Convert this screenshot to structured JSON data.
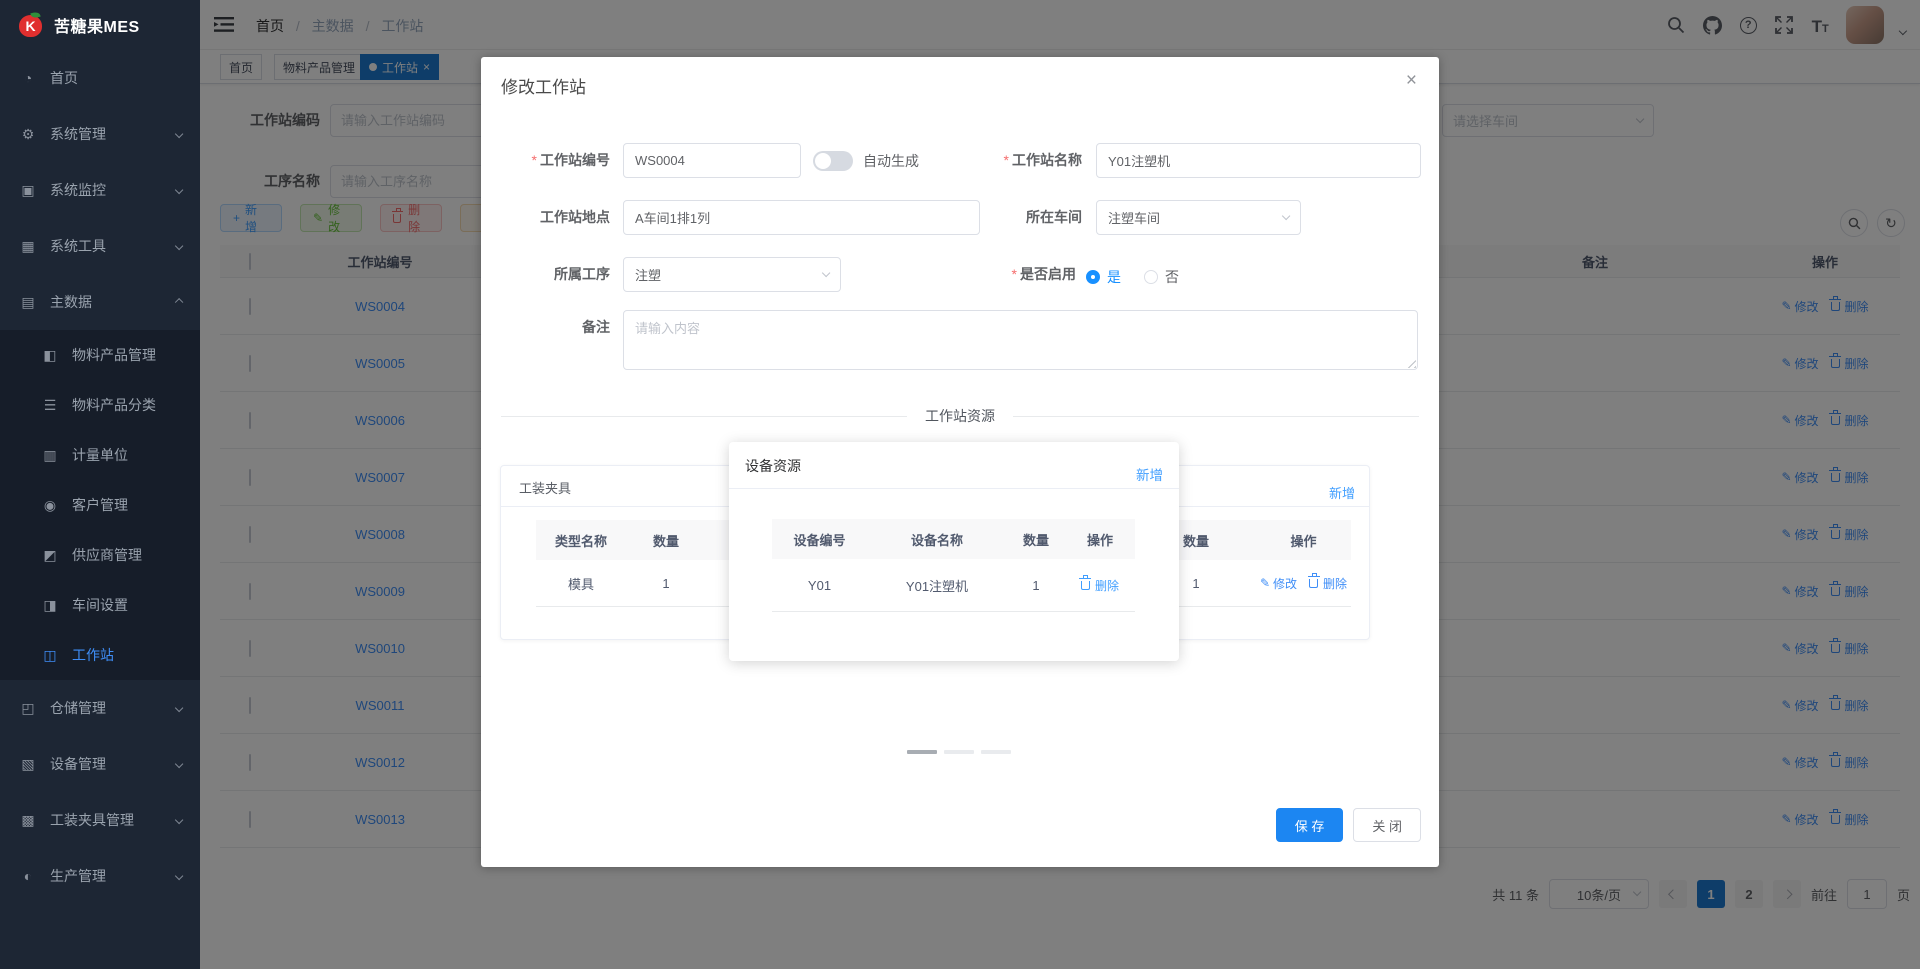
{
  "app": {
    "title": "苦糖果MES"
  },
  "sidebar": {
    "items_top": [
      {
        "label": "首页",
        "glyph": "◔"
      },
      {
        "label": "系统管理",
        "glyph": "⚙"
      },
      {
        "label": "系统监控",
        "glyph": "▣"
      },
      {
        "label": "系统工具",
        "glyph": "▦"
      },
      {
        "label": "主数据",
        "glyph": "▤"
      }
    ],
    "sub_master": [
      {
        "label": "物料产品管理",
        "glyph": "◧"
      },
      {
        "label": "物料产品分类",
        "glyph": "☰"
      },
      {
        "label": "计量单位",
        "glyph": "▥"
      },
      {
        "label": "客户管理",
        "glyph": "◉"
      },
      {
        "label": "供应商管理",
        "glyph": "◩"
      },
      {
        "label": "车间设置",
        "glyph": "◨"
      },
      {
        "label": "工作站",
        "glyph": "◫"
      }
    ],
    "items_bottom": [
      {
        "label": "仓储管理",
        "glyph": "◰"
      },
      {
        "label": "设备管理",
        "glyph": "▧"
      },
      {
        "label": "工装夹具管理",
        "glyph": "▩"
      },
      {
        "label": "生产管理",
        "glyph": "◐"
      }
    ]
  },
  "navbar": {
    "separator": "/",
    "breadcrumb": [
      "首页",
      "主数据",
      "工作站"
    ],
    "question_glyph": "?",
    "font_large": "T",
    "font_small": "T"
  },
  "tags": [
    {
      "label": "首页"
    },
    {
      "label": "物料产品管理"
    },
    {
      "label": "工作站"
    }
  ],
  "icons": {
    "close": "×",
    "pencil": "✎",
    "plus": "+",
    "refresh": "↻"
  },
  "search": {
    "code_label": "工作站编码",
    "code_placeholder": "请输入工作站编码",
    "process_label": "工序名称",
    "process_placeholder": "请输入工序名称",
    "workshop_placeholder": "请选择车间"
  },
  "toolbar": {
    "add": "新增",
    "edit": "修改",
    "delete": "删除"
  },
  "table": {
    "headers": {
      "code": "工作站编号",
      "remark": "备注",
      "actions": "操作"
    },
    "action_edit": "修改",
    "action_delete": "删除",
    "rows": [
      {
        "code": "WS0004"
      },
      {
        "code": "WS0005"
      },
      {
        "code": "WS0006"
      },
      {
        "code": "WS0007"
      },
      {
        "code": "WS0008"
      },
      {
        "code": "WS0009"
      },
      {
        "code": "WS0010"
      },
      {
        "code": "WS0011"
      },
      {
        "code": "WS0012"
      },
      {
        "code": "WS0013"
      }
    ]
  },
  "pagination": {
    "total": "共 11 条",
    "page_size": "10条/页",
    "pages": [
      "1",
      "2"
    ],
    "goto_label": "前往",
    "goto_value": "1",
    "goto_suffix": "页"
  },
  "modal": {
    "title": "修改工作站",
    "fields": {
      "code_label": "工作站编号",
      "code_value": "WS0004",
      "auto_generate": "自动生成",
      "name_label": "工作站名称",
      "name_value": "Y01注塑机",
      "location_label": "工作站地点",
      "location_value": "A车间1排1列",
      "workshop_label": "所在车间",
      "workshop_value": "注塑车间",
      "process_label": "所属工序",
      "process_value": "注塑",
      "enabled_label": "是否启用",
      "enabled_yes": "是",
      "enabled_no": "否",
      "remark_label": "备注",
      "remark_placeholder": "请输入内容"
    },
    "divider_title": "工作站资源",
    "fixture_card": {
      "title": "工装夹具",
      "header_type": "类型名称",
      "header_qty": "数量",
      "row_type": "模具",
      "row_qty": "1"
    },
    "right_card": {
      "add": "新增",
      "header_qty": "数量",
      "header_actions": "操作",
      "row_qty": "1",
      "action_edit": "修改",
      "action_delete": "删除"
    },
    "device_panel": {
      "title": "设备资源",
      "add": "新增",
      "header_code": "设备编号",
      "header_name": "设备名称",
      "header_qty": "数量",
      "header_actions": "操作",
      "row_code": "Y01",
      "row_name": "Y01注塑机",
      "row_qty": "1",
      "action_delete": "删除"
    },
    "save": "保 存",
    "close": "关 闭"
  }
}
